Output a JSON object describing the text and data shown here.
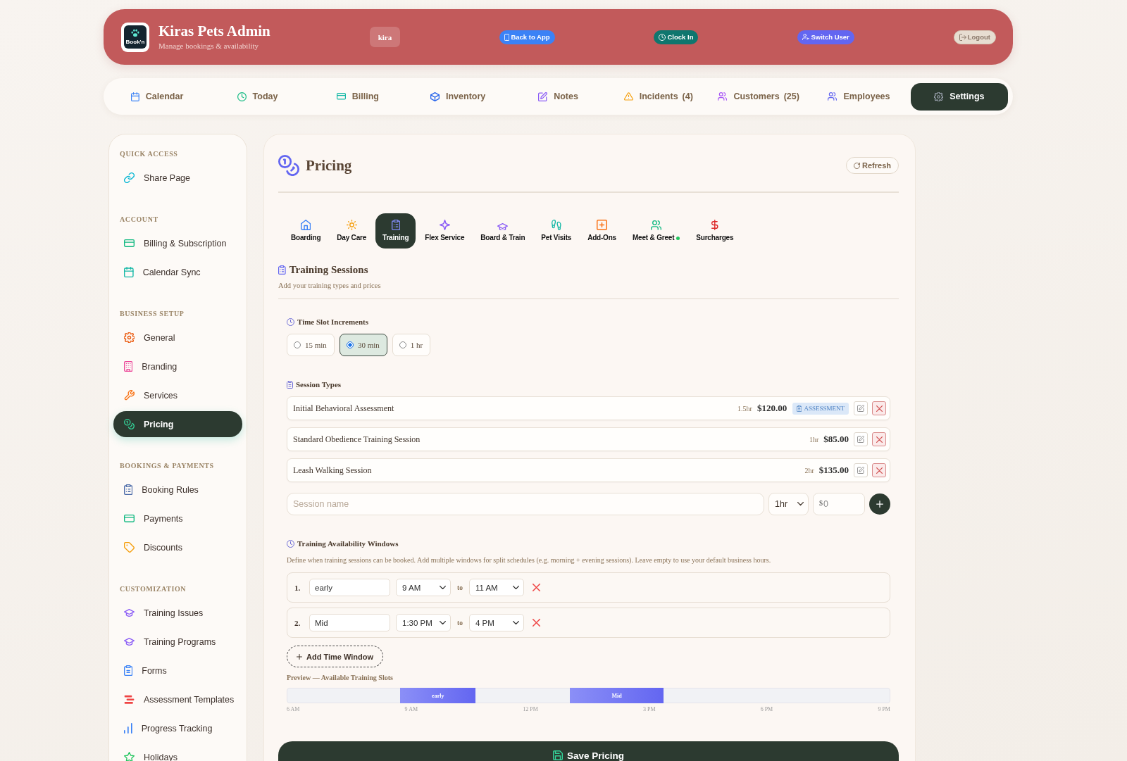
{
  "header": {
    "logo": {
      "text": "Book'n"
    },
    "title": "Kiras Pets Admin",
    "subtitle": "Manage bookings & availability",
    "user": "kira",
    "buttons": [
      {
        "label": "Back to App",
        "color": "#3b82f6"
      },
      {
        "label": "Clock In",
        "color": "#0f766e"
      },
      {
        "label": "Switch User",
        "color": "#6366f1"
      },
      {
        "label": "Logout",
        "color": "#e7ddd1"
      }
    ]
  },
  "nav": {
    "items": [
      {
        "label": "Calendar",
        "selected": false
      },
      {
        "label": "Today",
        "selected": false
      },
      {
        "label": "Billing",
        "selected": false
      },
      {
        "label": "Inventory",
        "selected": false
      },
      {
        "label": "Notes",
        "selected": false
      },
      {
        "label": "Incidents",
        "count": "(4)",
        "selected": false
      },
      {
        "label": "Customers",
        "count": "(25)",
        "selected": false
      },
      {
        "label": "Employees",
        "selected": false
      },
      {
        "label": "Settings",
        "selected": true
      }
    ]
  },
  "sidebar": {
    "sections": [
      {
        "heading": "QUICK ACCESS",
        "items": [
          {
            "label": "Share Page",
            "selected": false
          }
        ]
      },
      {
        "heading": "ACCOUNT",
        "items": [
          {
            "label": "Billing & Subscription",
            "selected": false
          },
          {
            "label": "Calendar Sync",
            "selected": false
          }
        ]
      },
      {
        "heading": "BUSINESS SETUP",
        "items": [
          {
            "label": "General",
            "selected": false
          },
          {
            "label": "Branding",
            "selected": false
          },
          {
            "label": "Services",
            "selected": false
          },
          {
            "label": "Pricing",
            "selected": true
          }
        ]
      },
      {
        "heading": "BOOKINGS & PAYMENTS",
        "items": [
          {
            "label": "Booking Rules",
            "selected": false
          },
          {
            "label": "Payments",
            "selected": false
          },
          {
            "label": "Discounts",
            "selected": false
          }
        ]
      },
      {
        "heading": "CUSTOMIZATION",
        "items": [
          {
            "label": "Training Issues",
            "selected": false
          },
          {
            "label": "Training Programs",
            "selected": false
          },
          {
            "label": "Forms",
            "selected": false
          },
          {
            "label": "Assessment Templates",
            "selected": false
          },
          {
            "label": "Progress Tracking",
            "selected": false
          },
          {
            "label": "Holidays",
            "selected": false
          }
        ]
      }
    ]
  },
  "main": {
    "title": "Pricing",
    "refresh": "Refresh",
    "tabs": [
      {
        "label": "Boarding",
        "selected": false,
        "dot": false
      },
      {
        "label": "Day Care",
        "selected": false,
        "dot": false
      },
      {
        "label": "Training",
        "selected": true,
        "dot": false
      },
      {
        "label": "Flex Service",
        "selected": false,
        "dot": false
      },
      {
        "label": "Board & Train",
        "selected": false,
        "dot": false
      },
      {
        "label": "Pet Visits",
        "selected": false,
        "dot": false
      },
      {
        "label": "Add-Ons",
        "selected": false,
        "dot": false
      },
      {
        "label": "Meet & Greet",
        "selected": false,
        "dot": true
      },
      {
        "label": "Surcharges",
        "selected": false,
        "dot": false
      }
    ],
    "section": {
      "title": "Training Sessions",
      "subtitle": "Add your training types and prices"
    },
    "increments": {
      "label": "Time Slot Increments",
      "options": [
        {
          "label": "15 min",
          "selected": false
        },
        {
          "label": "30 min",
          "selected": true
        },
        {
          "label": "1 hr",
          "selected": false
        }
      ]
    },
    "session_types": {
      "label": "Session Types",
      "rows": [
        {
          "name": "Initial Behavioral Assessment",
          "duration": "1.5hr",
          "price": "$120.00",
          "tag": "ASSESSMENT"
        },
        {
          "name": "Standard Obedience Training Session",
          "duration": "1hr",
          "price": "$85.00"
        },
        {
          "name": "Leash Walking Session",
          "duration": "2hr",
          "price": "$135.00"
        }
      ]
    },
    "new_session": {
      "placeholder": "Session name",
      "duration": "1hr",
      "price_prefix": "$",
      "price_placeholder": "0"
    },
    "availability": {
      "label": "Training Availability Windows",
      "description": "Define when training sessions can be booked. Add multiple windows for split schedules (e.g. morning + evening sessions). Leave empty to use your default business hours.",
      "windows": [
        {
          "number": "1.",
          "name": "early",
          "start": "9 AM",
          "connector": "to",
          "end": "11 AM"
        },
        {
          "number": "2.",
          "name": "Mid",
          "start": "1:30 PM",
          "connector": "to",
          "end": "4 PM"
        }
      ],
      "add_button": "Add Time Window"
    },
    "preview": {
      "label": "Preview — Available Training Slots",
      "blocks": [
        {
          "label": "early"
        },
        {
          "label": "Mid"
        }
      ],
      "ticks": [
        "6 AM",
        "9 AM",
        "12 PM",
        "3 PM",
        "6 PM",
        "9 PM"
      ]
    },
    "save": "Save Pricing"
  }
}
